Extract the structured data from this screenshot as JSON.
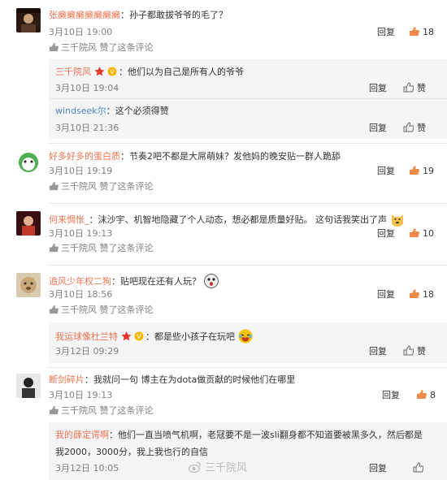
{
  "actions": {
    "reply": "回复",
    "like": "赞"
  },
  "liked_suffix": "赞了这条评论",
  "comments": [
    {
      "user": "张癞癞癞癞癞癞癞",
      "text": "：孙子都敢拔爷爷的毛了？",
      "time": "3月10日 19:00",
      "likes": "18",
      "liker": "三千院风",
      "replies": [
        {
          "user": "三千院风",
          "text": "：他们以为自己是所有人的爷爷",
          "time": "3月10日 19:04"
        },
        {
          "user": "windseek尔",
          "text": "：这个必须得赞",
          "time": "3月10日 21:36"
        }
      ]
    },
    {
      "user": "好多好多的蛋白质",
      "text": "：节奏2吧不都是大屌萌妹？发他妈的晚安贴一群人跪舔",
      "time": "3月10日 19:19",
      "likes": "19",
      "liker": "三千院风"
    },
    {
      "user": "何来惆怅_",
      "text": "：沫沙宇、机智地隐藏了个人动态，想必都是质量好贴。 这句话我笑出了声",
      "time": "3月10日 19:13",
      "likes": "10",
      "liker": "三千院风"
    },
    {
      "user": "追风少年权二狗",
      "text": "：贴吧现在还有人玩？",
      "time": "3月10日 18:56",
      "likes": "18",
      "liker": "三千院风",
      "replies": [
        {
          "user": "我运球像杜兰特",
          "text": "：都是些小孩子在玩吧",
          "time": "3月12日 09:29"
        }
      ]
    },
    {
      "user": "断剑碎片",
      "text": "：我就问一句 博主在为dota做贡献的时候他们在哪里",
      "time": "3月10日 19:13",
      "likes": "8",
      "liker": "三千院风",
      "replies": [
        {
          "user": "我的薛定谔啊",
          "text": "：他们一直当喷气机啊，老冦要不是一波sli翻身都不知道要被黑多久，然后都是",
          "text2": "我2000，3000分，我上我也行的自信",
          "time": "3月12日 10:05"
        }
      ]
    }
  ],
  "watermark": "三千院风",
  "colors": {
    "username": "#eb7350",
    "link_blue": "#4d85c8",
    "like_orange": "#f08a4b",
    "reply_bg": "#f4f5f7"
  }
}
